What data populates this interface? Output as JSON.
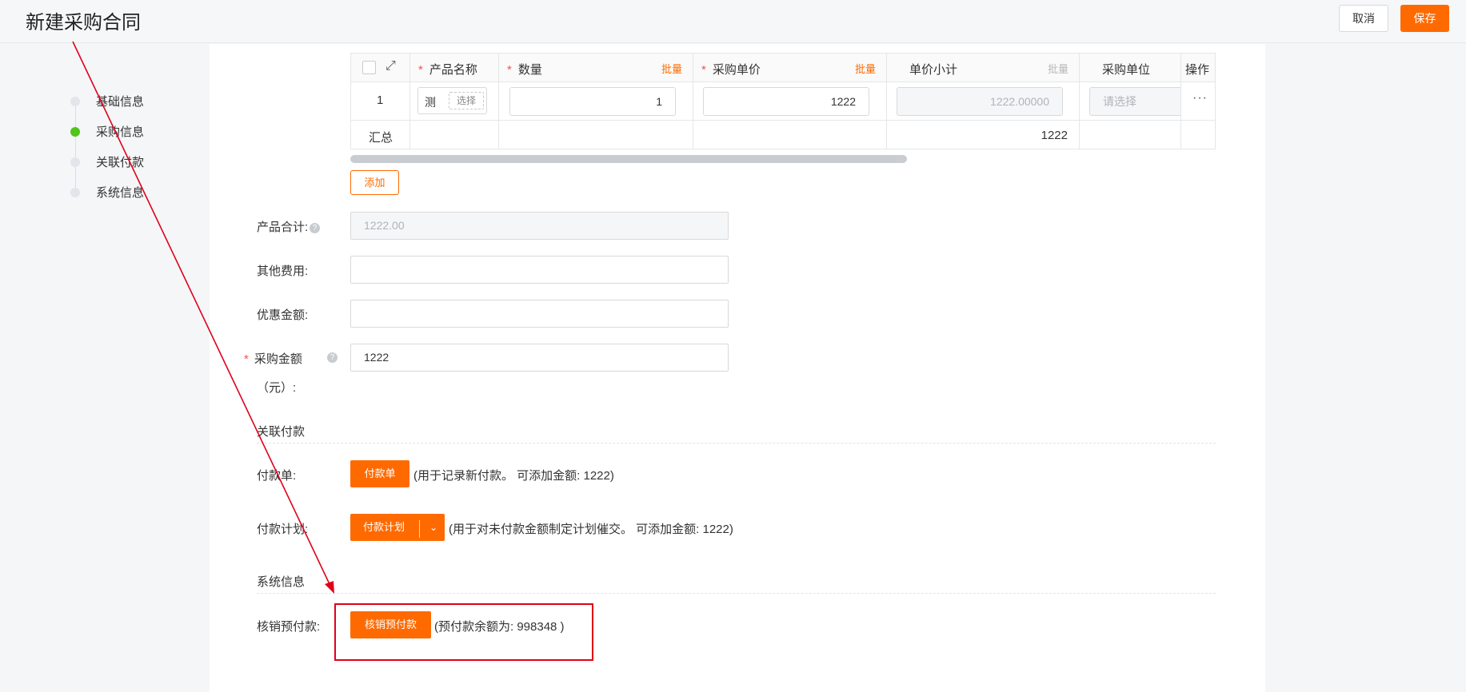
{
  "header": {
    "title": "新建采购合同",
    "cancel_label": "取消",
    "save_label": "保存"
  },
  "steps": [
    {
      "label": "基础信息",
      "active": false
    },
    {
      "label": "采购信息",
      "active": true
    },
    {
      "label": "关联付款",
      "active": false
    },
    {
      "label": "系统信息",
      "active": false
    }
  ],
  "table": {
    "headers": {
      "product_name": "产品名称",
      "quantity": "数量",
      "unit_price": "采购单价",
      "subtotal": "单价小计",
      "unit": "采购单位",
      "operation": "操作"
    },
    "required_mark": "*",
    "batch_label": "批量",
    "row": {
      "index": "1",
      "product": "测",
      "select_label": "选择",
      "quantity": "1",
      "unit_price": "1222",
      "subtotal": "1222.00000",
      "unit_placeholder": "请选择",
      "more": "···"
    },
    "summary": {
      "label": "汇总",
      "subtotal": "1222"
    },
    "add_label": "添加"
  },
  "form": {
    "product_total_label": "产品合计:",
    "product_total_value": "1222.00",
    "other_fee_label": "其他费用:",
    "discount_label": "优惠金额:",
    "purchase_amount_label_1": "采购金额",
    "purchase_amount_label_2": "（元）:",
    "purchase_amount_value": "1222",
    "help_icon": "?"
  },
  "related_payment": {
    "section_title": "关联付款",
    "payment_label": "付款单:",
    "payment_button": "付款单",
    "payment_note": "(用于记录新付款。 可添加金额: 1222)",
    "plan_label": "付款计划:",
    "plan_button": "付款计划",
    "plan_note": "(用于对未付款金额制定计划催交。 可添加金额: 1222)"
  },
  "system_info": {
    "section_title": "系统信息",
    "prepay_label": "核销预付款:",
    "prepay_button": "核销预付款",
    "prepay_note": "(预付款余额为: 998348 )"
  },
  "colors": {
    "accent": "#ff6a00",
    "annotation": "#e0001b",
    "active_step": "#52c41a"
  }
}
